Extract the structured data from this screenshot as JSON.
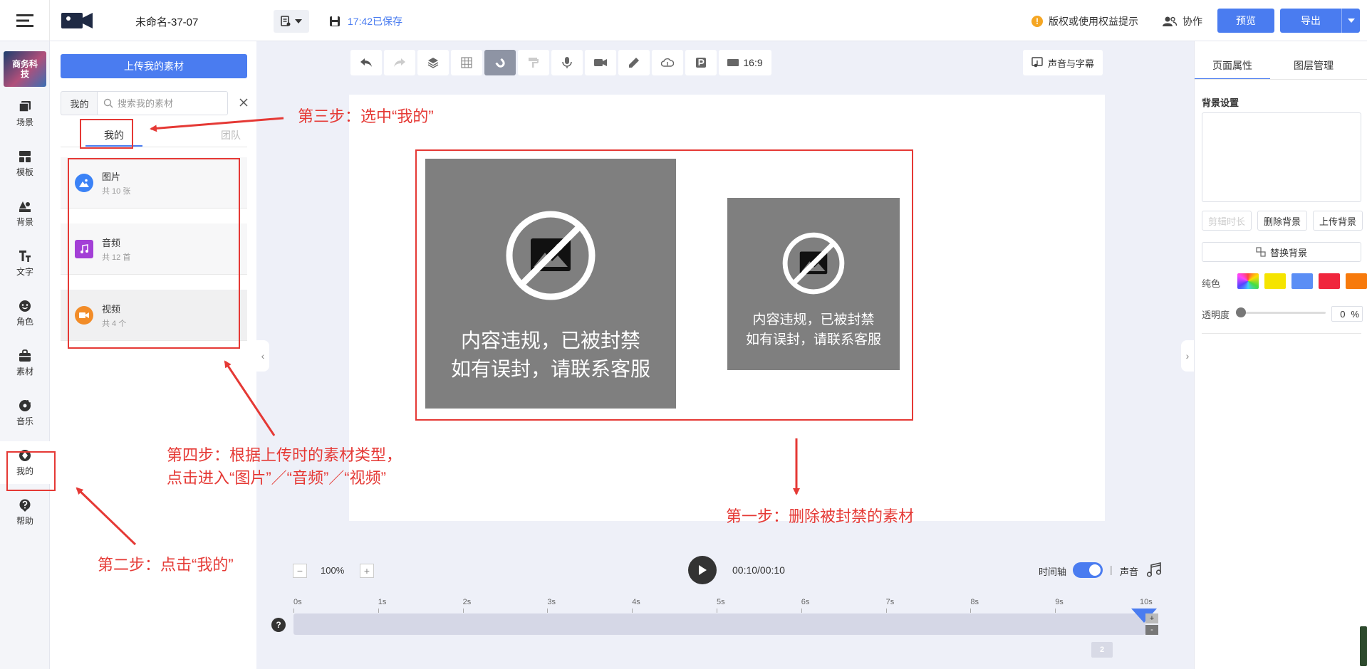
{
  "topbar": {
    "doc_title": "未命名-37-07",
    "save_status": "17:42已保存",
    "copyright_notice": "版权或使用权益提示",
    "collab_label": "协作",
    "preview_label": "预览",
    "export_label": "导出"
  },
  "rail": {
    "avatar_text": "商务科技",
    "items": [
      {
        "label": "场景",
        "icon": "scene-icon"
      },
      {
        "label": "模板",
        "icon": "template-icon"
      },
      {
        "label": "背景",
        "icon": "background-icon"
      },
      {
        "label": "文字",
        "icon": "text-icon"
      },
      {
        "label": "角色",
        "icon": "character-icon"
      },
      {
        "label": "素材",
        "icon": "material-icon"
      },
      {
        "label": "音乐",
        "icon": "music-icon"
      },
      {
        "label": "我的",
        "icon": "mine-icon"
      },
      {
        "label": "帮助",
        "icon": "help-icon"
      }
    ]
  },
  "assets": {
    "upload_label": "上传我的素材",
    "search_scope": "我的",
    "search_placeholder": "搜索我的素材",
    "tab_mine": "我的",
    "tab_team": "团队",
    "categories": [
      {
        "name": "图片",
        "count": "共 10 张",
        "color": "#3b82f6"
      },
      {
        "name": "音频",
        "count": "共 12 首",
        "color": "#a33fd6"
      },
      {
        "name": "视频",
        "count": "共 4 个",
        "color": "#f28c28"
      }
    ]
  },
  "canvas": {
    "ratio_label": "16:9",
    "voice_subtitle_label": "声音与字幕",
    "blocked_text_line1": "内容违规，已被封禁",
    "blocked_text_line2": "如有误封，请联系客服"
  },
  "playback": {
    "zoom_value": "100%",
    "zoom_minus": "−",
    "zoom_plus": "+",
    "timecode": "00:10/00:10",
    "timeline_label": "时间轴",
    "separator": "|",
    "sound_label": "声音",
    "help_glyph": "?",
    "track_plus": "+",
    "track_minus": "-",
    "ruler_ticks": [
      "0s",
      "1s",
      "2s",
      "3s",
      "4s",
      "5s",
      "6s",
      "7s",
      "8s",
      "9s",
      "10s"
    ],
    "page_count": "2",
    "timeline_enabled": true
  },
  "right_panel": {
    "tab_page_props": "页面属性",
    "tab_layers": "图层管理",
    "section_background": "背景设置",
    "btn_trim": "剪辑时长",
    "btn_delete_bg": "删除背景",
    "btn_upload_bg": "上传背景",
    "btn_replace_bg": "替换背景",
    "solid_color_label": "纯色",
    "swatches": [
      "#f5e400",
      "#5b8ef5",
      "#f0263d",
      "#f77a0c"
    ],
    "opacity_label": "透明度",
    "opacity_value": "0",
    "opacity_unit": "%"
  },
  "annotations": {
    "step1": "第一步：删除被封禁的素材",
    "step2": "第二步：点击“我的”",
    "step3": "第三步：选中“我的”",
    "step4_line1": "第四步：根据上传时的素材类型，",
    "step4_line2": "点击进入“图片”／“音频”／“视频”",
    "color": "#e53935"
  }
}
